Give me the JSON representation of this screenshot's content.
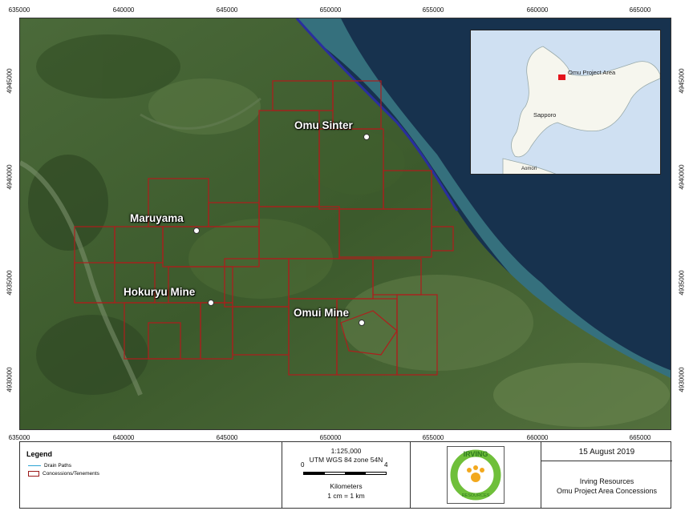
{
  "axes": {
    "x_labels": [
      "635000",
      "640000",
      "645000",
      "650000",
      "655000",
      "660000",
      "665000"
    ],
    "y_labels": [
      "4945000",
      "4940000",
      "4935000",
      "4930000"
    ]
  },
  "places": [
    {
      "name": "Omu Sinter"
    },
    {
      "name": "Maruyama"
    },
    {
      "name": "Hokuryu Mine"
    },
    {
      "name": "Omui Mine"
    }
  ],
  "inset": {
    "project_label": "Omu Project Area",
    "city_label": "Sapporo",
    "south_label": "Aomori",
    "marker_color": "#e4141b"
  },
  "legend": {
    "title": "Legend",
    "items": [
      {
        "label": "Drain Paths",
        "color": "#2ba3d4"
      },
      {
        "label": "Concessions/Tenements",
        "color": "#9b1a1a"
      }
    ]
  },
  "scale": {
    "ratio": "1:125,000",
    "projection": "UTM WGS 84 zone 54N",
    "tick_start": "0",
    "tick_end": "4",
    "units": "Kilometers",
    "conversion": "1 cm = 1 km"
  },
  "logo": {
    "text": "IRVING",
    "subtext": "RESOURCES"
  },
  "info": {
    "date": "15 August 2019",
    "company": "Irving Resources",
    "title": "Omu Project Area Concessions"
  },
  "colors": {
    "land": "#3d5a2a",
    "sea": "#1a3550",
    "concession": "#b01c1c",
    "coastline": "#2a2f9e"
  }
}
